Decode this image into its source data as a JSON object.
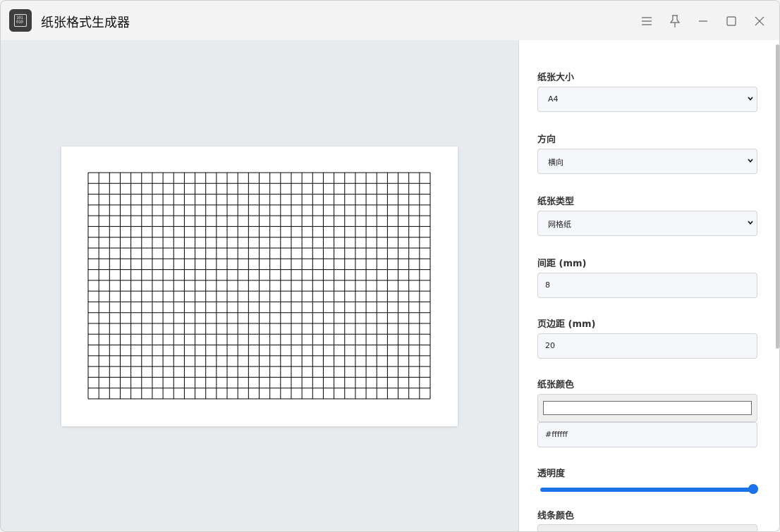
{
  "window": {
    "title": "纸张格式生成器",
    "app_icon_text": [
      "101",
      "010"
    ]
  },
  "preview": {
    "paper_color": "#ffffff",
    "line_color": "#000000",
    "grid_columns": 32,
    "grid_rows": 21
  },
  "settings": {
    "paper_size": {
      "label": "纸张大小",
      "value": "A4"
    },
    "orientation": {
      "label": "方向",
      "value": "横向"
    },
    "paper_type": {
      "label": "纸张类型",
      "value": "网格纸"
    },
    "spacing": {
      "label": "间距 (mm)",
      "value": "8"
    },
    "margin": {
      "label": "页边距 (mm)",
      "value": "20"
    },
    "paper_color": {
      "label": "纸张颜色",
      "value": "#ffffff"
    },
    "opacity": {
      "label": "透明度",
      "level": 1.0
    },
    "line_color": {
      "label": "线条颜色"
    }
  },
  "colors": {
    "accent": "#1a73e8",
    "sidebar_bg": "#ffffff",
    "canvas_bg": "#e8ebee"
  }
}
